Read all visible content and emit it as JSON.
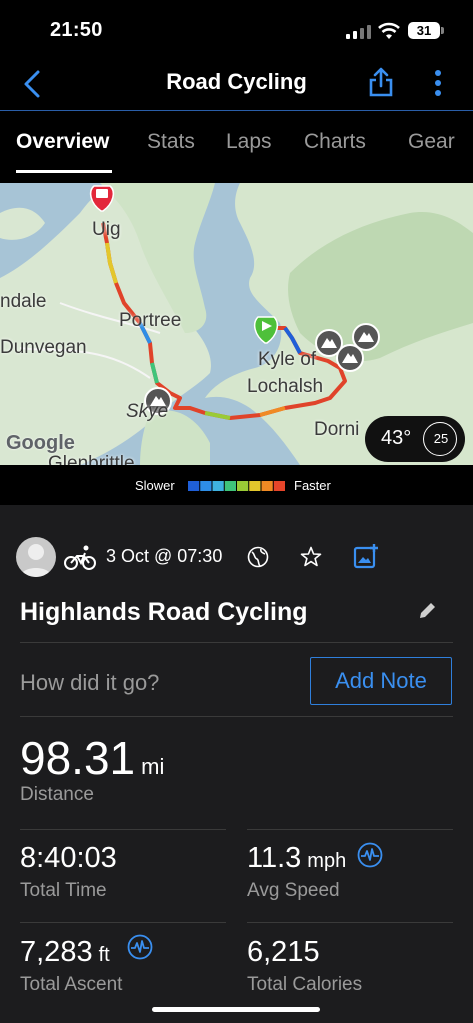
{
  "status_bar": {
    "time": "21:50",
    "battery": "31"
  },
  "nav": {
    "title": "Road Cycling"
  },
  "tabs": [
    "Overview",
    "Stats",
    "Laps",
    "Charts",
    "Gear"
  ],
  "map": {
    "places": [
      "Uig",
      "ndale",
      "Portree",
      "Dunvegan",
      "Skye",
      "Kyle of",
      "Lochalsh",
      "Dorni",
      "Glenbrittle"
    ],
    "attribution": "Google",
    "weather": {
      "temperature": "43°",
      "wind": "25"
    }
  },
  "legend": {
    "slower": "Slower",
    "faster": "Faster",
    "colors": [
      "#1f5fd8",
      "#2e8ee6",
      "#3fb2e0",
      "#3fc47a",
      "#9acb36",
      "#e3c72c",
      "#f08a24",
      "#e6452a"
    ]
  },
  "activity": {
    "date": "3 Oct @ 07:30",
    "name": "Highlands Road Cycling",
    "prompt": "How did it go?",
    "add_note": "Add Note"
  },
  "stats": {
    "distance": {
      "value": "98.31",
      "unit": "mi",
      "label": "Distance"
    },
    "total_time": {
      "value": "8:40:03",
      "label": "Total Time"
    },
    "avg_speed": {
      "value": "11.3",
      "unit": "mph",
      "label": "Avg Speed"
    },
    "total_ascent": {
      "value": "7,283",
      "unit": "ft",
      "label": "Total Ascent"
    },
    "total_calories": {
      "value": "6,215",
      "label": "Total Calories"
    }
  },
  "colors": {
    "accent": "#2f7fdc",
    "background": "#000000",
    "panel": "#1c1c1e"
  }
}
